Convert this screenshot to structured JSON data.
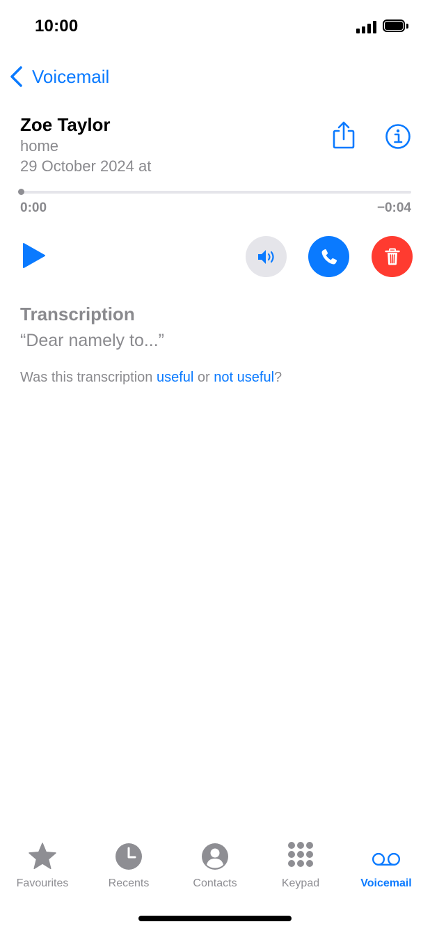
{
  "status_bar": {
    "time": "10:00"
  },
  "nav": {
    "back_label": "Voicemail"
  },
  "voicemail": {
    "caller_name": "Zoe Taylor",
    "label": "home",
    "date": "29 October 2024 at",
    "elapsed": "0:00",
    "remaining": "−0:04",
    "progress_fraction": 0
  },
  "transcription": {
    "title": "Transcription",
    "text": "“Dear namely to...”",
    "feedback_prefix": "Was this transcription ",
    "useful": "useful",
    "feedback_or": " or ",
    "not_useful": "not useful",
    "feedback_suffix": "?"
  },
  "tabs": [
    {
      "label": "Favourites",
      "icon": "star-icon",
      "active": false
    },
    {
      "label": "Recents",
      "icon": "clock-icon",
      "active": false
    },
    {
      "label": "Contacts",
      "icon": "person-circle-icon",
      "active": false
    },
    {
      "label": "Keypad",
      "icon": "keypad-icon",
      "active": false
    },
    {
      "label": "Voicemail",
      "icon": "voicemail-icon",
      "active": true
    }
  ],
  "colors": {
    "accent": "#0a7aff",
    "destructive": "#ff3b30",
    "secondary_text": "#8a8a8e"
  }
}
